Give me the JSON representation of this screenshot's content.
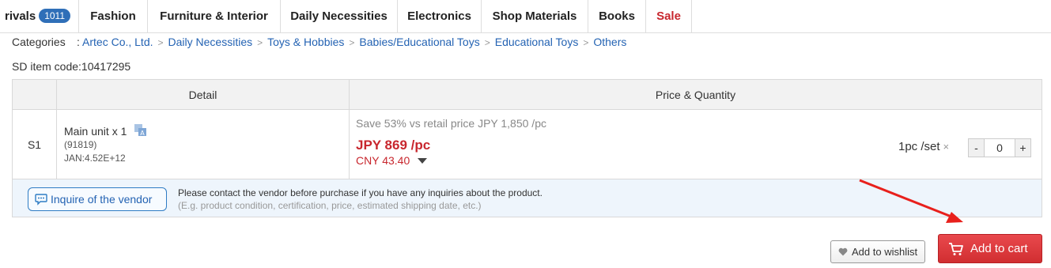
{
  "nav": {
    "tabs": [
      {
        "label": "rivals",
        "badge": "1011"
      },
      {
        "label": "Fashion"
      },
      {
        "label": "Furniture & Interior"
      },
      {
        "label": "Daily Necessities"
      },
      {
        "label": "Electronics"
      },
      {
        "label": "Shop Materials"
      },
      {
        "label": "Books"
      },
      {
        "label": "Sale"
      }
    ]
  },
  "breadcrumb": {
    "label": "Categories",
    "colon": ":",
    "items": [
      "Artec Co., Ltd.",
      "Daily Necessities",
      "Toys & Hobbies",
      "Babies/Educational Toys",
      "Educational Toys",
      "Others"
    ],
    "separator": ">"
  },
  "item_code": "SD item code:10417295",
  "table": {
    "headers": {
      "detail": "Detail",
      "price_qty": "Price & Quantity"
    },
    "row": {
      "sku": "S1",
      "detail_main": "Main unit x 1",
      "detail_model": "(91819)",
      "detail_jan": "JAN:4.52E+12",
      "save_text": "Save 53% vs retail price JPY 1,850 /pc",
      "price": "JPY 869 /pc",
      "cny": "CNY 43.40",
      "unit": "1pc /set",
      "unit_x": "×",
      "qty_minus": "-",
      "qty_value": "0",
      "qty_plus": "+"
    }
  },
  "inquiry": {
    "button": "Inquire of the vendor",
    "text": "Please contact the vendor before purchase if you have any inquiries about the product.",
    "note": "(E.g. product condition, certification, price, estimated shipping date, etc.)"
  },
  "actions": {
    "wishlist": "Add to wishlist",
    "cart": "Add to cart"
  },
  "colors": {
    "accent_blue": "#2463b3",
    "price_red": "#c8272e",
    "cart_red": "#d12e31",
    "annotation_arrow": "#e8201c"
  },
  "icons": [
    "translate-icon",
    "chat-bubble-icon",
    "heart-icon",
    "cart-icon",
    "caret-down-icon"
  ]
}
